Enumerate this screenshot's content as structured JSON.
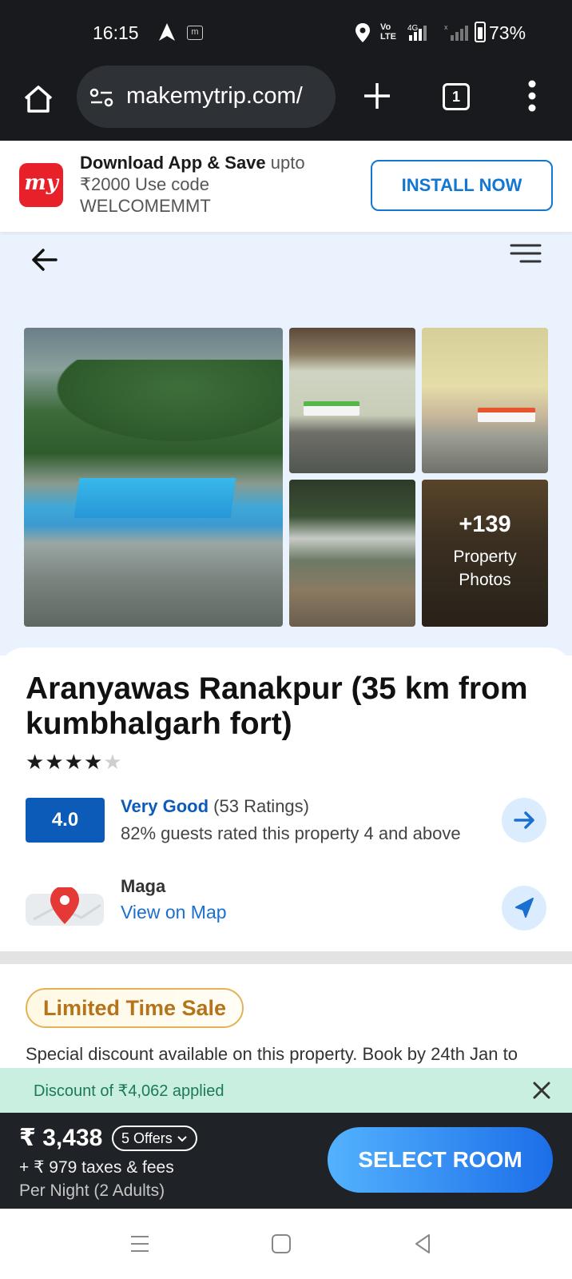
{
  "status_bar": {
    "time": "16:15",
    "m_badge": "m",
    "volte": "Vo LTE",
    "network": "4G",
    "battery": "73%"
  },
  "browser": {
    "url": "makemytrip.com/",
    "tab_count": "1"
  },
  "app_banner": {
    "logo_text": "my",
    "title": "Download App & Save",
    "title_suffix": " upto",
    "line2": "₹2000 Use code",
    "line3": "WELCOMEMMT",
    "install_label": "INSTALL NOW"
  },
  "gallery": {
    "more_count": "+139",
    "more_label_1": "Property",
    "more_label_2": "Photos"
  },
  "hotel": {
    "name": "Aranyawas Ranakpur (35 km from kumbhalgarh fort)",
    "star_rating": 4,
    "star_max": 5,
    "rating_score": "4.0",
    "rating_word": "Very Good",
    "rating_count": " (53 Ratings)",
    "rating_summary": "82% guests rated this property 4 and above",
    "location": "Maga",
    "view_map_label": "View on Map"
  },
  "sale": {
    "badge": "Limited Time Sale",
    "text": "Special discount available on this property. Book by 24th Jan to"
  },
  "discount": {
    "text": "Discount of ₹4,062 applied"
  },
  "price": {
    "amount": "₹ 3,438",
    "offers_label": "5 Offers",
    "taxes": "+ ₹ 979 taxes & fees",
    "per_night": "Per Night (2 Adults)",
    "cta_label": "SELECT ROOM"
  },
  "colors": {
    "brand_red": "#e8202a",
    "primary_blue": "#0c5bb8",
    "link_blue": "#1a6fd0",
    "discount_green_bg": "#c9efe0",
    "sale_gold": "#b3741b"
  }
}
